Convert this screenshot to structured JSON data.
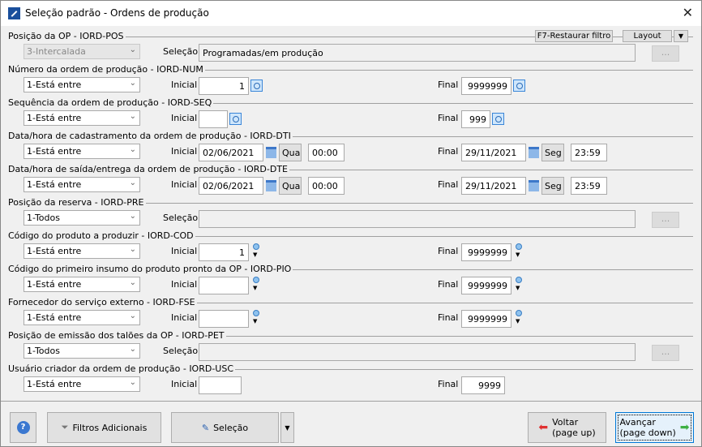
{
  "window": {
    "title": "Seleção padrão - Ordens de produção",
    "close_icon": "close-icon"
  },
  "toolbar": {
    "restore_filter": "F7-Restaurar filtro",
    "layout": "Layout"
  },
  "labels": {
    "inicial": "Inicial",
    "final": "Final",
    "selecao": "Seleção",
    "dots": "..."
  },
  "sections": [
    {
      "title": "Posição da OP - IORD-POS",
      "type": "selection",
      "combo": "3-Intercalada",
      "disabled": true,
      "selection": "Programadas/em produção"
    },
    {
      "title": "Número da ordem de produção - IORD-NUM",
      "type": "range",
      "combo": "1-Está entre",
      "initial": "1",
      "final": "9999999",
      "icon": "lookup",
      "iw": 62,
      "fw": 62
    },
    {
      "title": "Sequência da ordem de produção - IORD-SEQ",
      "type": "range",
      "combo": "1-Está entre",
      "initial": "",
      "final": "999",
      "icon": "lookup",
      "iw": 36,
      "fw": 36
    },
    {
      "title": "Data/hora de cadastramento da ordem de produção - IORD-DTI",
      "type": "date",
      "combo": "1-Está entre",
      "initial_date": "02/06/2021",
      "initial_day": "Qua",
      "initial_time": "00:00",
      "final_date": "29/11/2021",
      "final_day": "Seg",
      "final_time": "23:59"
    },
    {
      "title": "Data/hora de saída/entrega da ordem de produção - IORD-DTE",
      "type": "date",
      "combo": "1-Está entre",
      "initial_date": "02/06/2021",
      "initial_day": "Qua",
      "initial_time": "00:00",
      "final_date": "29/11/2021",
      "final_day": "Seg",
      "final_time": "23:59"
    },
    {
      "title": "Posição da reserva - IORD-PRE",
      "type": "selection",
      "combo": "1-Todos",
      "disabled": false,
      "selection": ""
    },
    {
      "title": "Código do produto a produzir - IORD-COD",
      "type": "range",
      "combo": "1-Está entre",
      "initial": "1",
      "final": "9999999",
      "icon": "search",
      "iw": 62,
      "fw": 62
    },
    {
      "title": "Código do primeiro insumo do produto pronto da OP - IORD-PIO",
      "type": "range",
      "combo": "1-Está entre",
      "initial": "",
      "final": "9999999",
      "icon": "search",
      "iw": 62,
      "fw": 62
    },
    {
      "title": "Fornecedor do serviço externo - IORD-FSE",
      "type": "range",
      "combo": "1-Está entre",
      "initial": "",
      "final": "9999999",
      "icon": "search",
      "iw": 62,
      "fw": 62
    },
    {
      "title": "Posição de emissão dos talões da OP - IORD-PET",
      "type": "selection",
      "combo": "1-Todos",
      "disabled": false,
      "selection": ""
    },
    {
      "title": "Usuário criador da ordem de produção - IORD-USC",
      "type": "range",
      "combo": "1-Está entre",
      "initial": "",
      "final": "9999",
      "icon": "none",
      "iw": 53,
      "fw": 54
    }
  ],
  "footer": {
    "help": "?",
    "filtros": "Filtros Adicionais",
    "selecao": "Seleção",
    "voltar_1": "Voltar",
    "voltar_2": "(page up)",
    "avancar_1": "Avançar",
    "avancar_2": "(page down)"
  }
}
